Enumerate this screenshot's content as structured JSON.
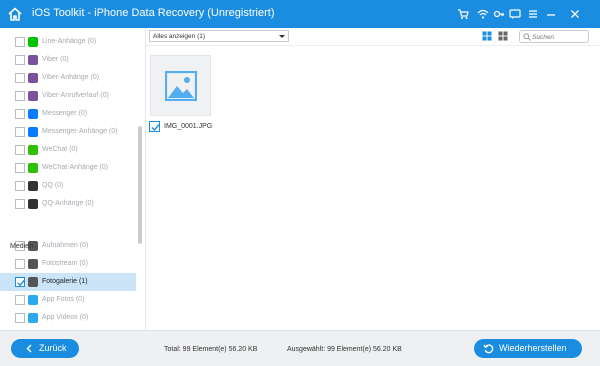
{
  "window": {
    "title": "iOS Toolkit - iPhone Data Recovery (Unregistriert)",
    "icons": [
      "home-icon",
      "cart-icon",
      "wifi-icon",
      "key-icon",
      "message-icon",
      "menu-icon",
      "minimize-icon",
      "close-icon"
    ],
    "accent": "#1a8de0"
  },
  "sidebar": {
    "items": [
      {
        "label": "Line-Anhänge (0)",
        "icon": "line-icon",
        "color": "#00c300"
      },
      {
        "label": "Viber (0)",
        "icon": "viber-icon",
        "color": "#7b519d"
      },
      {
        "label": "Viber-Anhänge (0)",
        "icon": "viber-icon",
        "color": "#7b519d"
      },
      {
        "label": "Viber-Anrufverlauf (0)",
        "icon": "viber-icon",
        "color": "#7b519d"
      },
      {
        "label": "Messenger (0)",
        "icon": "messenger-icon",
        "color": "#0a7cff"
      },
      {
        "label": "Messenger-Anhänge (0)",
        "icon": "messenger-icon",
        "color": "#0a7cff"
      },
      {
        "label": "WeChat (0)",
        "icon": "wechat-icon",
        "color": "#2dc100"
      },
      {
        "label": "WeChat-Anhänge (0)",
        "icon": "wechat-icon",
        "color": "#2dc100"
      },
      {
        "label": "QQ (0)",
        "icon": "qq-icon",
        "color": "#333333"
      },
      {
        "label": "QQ-Anhänge (0)",
        "icon": "qq-icon",
        "color": "#333333"
      }
    ],
    "section_media": "Medien",
    "media_items": [
      {
        "label": "Aufnahmen (0)",
        "icon": "camera-icon",
        "color": "#555555",
        "selected": false
      },
      {
        "label": "Fotostream (0)",
        "icon": "camera-icon",
        "color": "#555555",
        "selected": false
      },
      {
        "label": "Fotogalerie (1)",
        "icon": "gallery-icon",
        "color": "#555555",
        "selected": true
      },
      {
        "label": "App Fotos (0)",
        "icon": "app-photos-icon",
        "color": "#2aa8f0",
        "selected": false
      },
      {
        "label": "App Videos (0)",
        "icon": "app-videos-icon",
        "color": "#2aa8f0",
        "selected": false
      }
    ]
  },
  "toolbar": {
    "filter_value": "Alles anzeigen (1)",
    "search_placeholder": "Suchen"
  },
  "content": {
    "items": [
      {
        "name": "IMG_0001.JPG",
        "checked": true
      }
    ]
  },
  "footer": {
    "back_label": "Zurück",
    "total": "Total: 99 Element(e) 56.20 KB",
    "selected": "Ausgewählt: 99 Element(e) 56.20 KB",
    "restore_label": "Wiederherstellen"
  }
}
